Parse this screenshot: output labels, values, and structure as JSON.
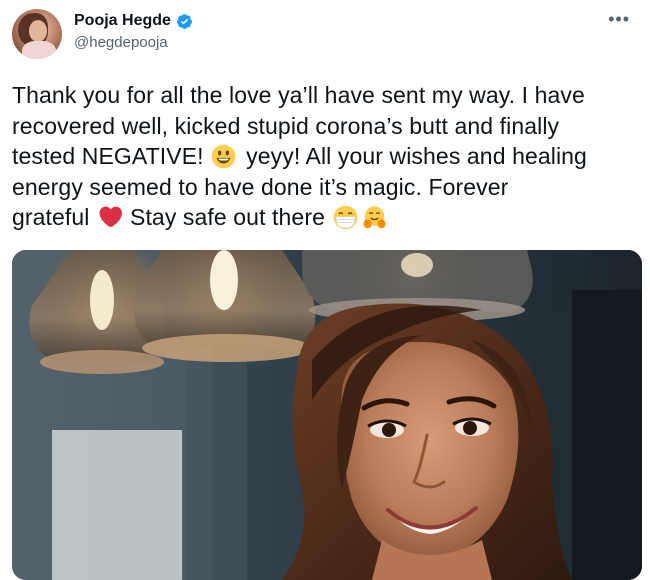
{
  "tweet": {
    "author": {
      "display_name": "Pooja Hegde",
      "handle": "@hegdepooja",
      "verified": true
    },
    "more_menu": "•••",
    "text_lines": [
      "Thank you for all the love ya’ll have sent my way. I have",
      "recovered well, kicked stupid corona’s butt and finally",
      "tested NEGATIVE!",
      " yeyy! All your wishes and healing",
      "energy seemed to have done it’s magic. Forever",
      "grateful",
      " Stay safe out there"
    ],
    "emojis": [
      "grinning-face-emoji",
      "red-heart-emoji",
      "face-with-medical-mask-emoji",
      "hugging-face-emoji"
    ],
    "media": {
      "type": "photo",
      "icon": "photo-portrait-woman-smiling-under-pendant-lamps"
    }
  },
  "colors": {
    "text": "#0f1419",
    "secondary_text": "#536471",
    "verified_blue": "#1d9bf0",
    "heart_red": "#dd2e44",
    "emoji_yellow": "#ffcc4d"
  }
}
